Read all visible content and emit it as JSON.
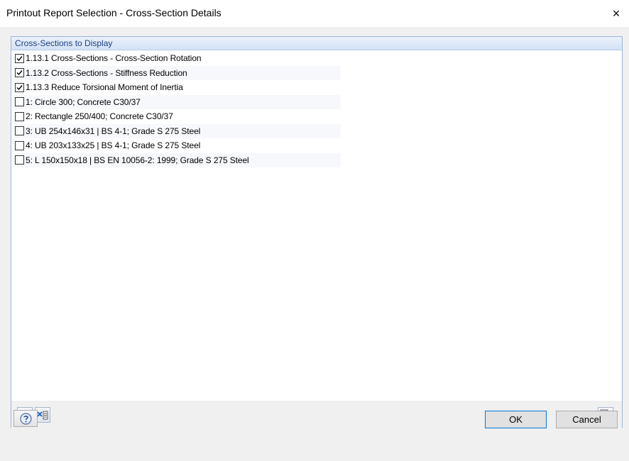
{
  "window": {
    "title": "Printout Report Selection - Cross-Section Details",
    "close_glyph": "×"
  },
  "group": {
    "title": "Cross-Sections to Display"
  },
  "items": [
    {
      "label": "1.13.1 Cross-Sections - Cross-Section Rotation",
      "checked": true
    },
    {
      "label": "1.13.2 Cross-Sections - Stiffness Reduction",
      "checked": true
    },
    {
      "label": "1.13.3 Reduce Torsional Moment of Inertia",
      "checked": true
    },
    {
      "label": "1: Circle 300; Concrete C30/37",
      "checked": false
    },
    {
      "label": "2: Rectangle 250/400; Concrete C30/37",
      "checked": false
    },
    {
      "label": "3: UB 254x146x31 | BS 4-1; Grade S 275 Steel",
      "checked": false
    },
    {
      "label": "4: UB 203x133x25 | BS 4-1; Grade S 275 Steel",
      "checked": false
    },
    {
      "label": "5: L 150x150x18 | BS EN 10056-2: 1999; Grade S 275 Steel",
      "checked": false
    }
  ],
  "toolbar": {
    "select_all_icon": "check-all-list-icon",
    "deselect_all_icon": "uncheck-all-list-icon",
    "preview_icon": "list-preview-magnifier-icon"
  },
  "buttons": {
    "help_icon": "help-icon",
    "ok": "OK",
    "cancel": "Cancel"
  },
  "colors": {
    "accent": "#0078d7",
    "group_border": "#9bb4d8",
    "group_title": "#1d3f84"
  }
}
